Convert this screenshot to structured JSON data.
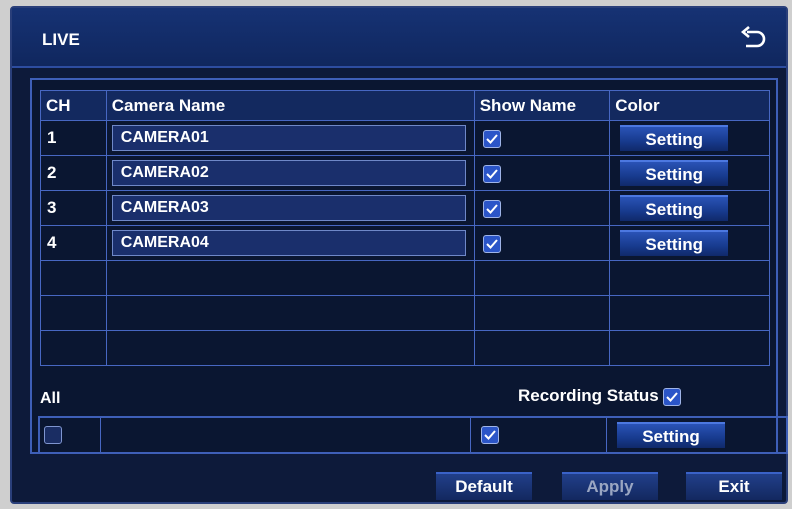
{
  "window": {
    "title": "LIVE"
  },
  "table": {
    "headers": {
      "ch": "CH",
      "name": "Camera Name",
      "show": "Show Name",
      "color": "Color"
    },
    "rows": [
      {
        "ch": "1",
        "name": "CAMERA01",
        "show_name": true,
        "color_btn": "Setting"
      },
      {
        "ch": "2",
        "name": "CAMERA02",
        "show_name": true,
        "color_btn": "Setting"
      },
      {
        "ch": "3",
        "name": "CAMERA03",
        "show_name": true,
        "color_btn": "Setting"
      },
      {
        "ch": "4",
        "name": "CAMERA04",
        "show_name": true,
        "color_btn": "Setting"
      }
    ]
  },
  "all": {
    "label": "All",
    "recording_status_label": "Recording Status",
    "recording_status_checked": true,
    "all_checked": false,
    "show_name_checked": true,
    "color_btn": "Setting"
  },
  "footer": {
    "default": "Default",
    "apply": "Apply",
    "exit": "Exit"
  },
  "colors": {
    "accent": "#2b55c8",
    "background": "#0d1a3a",
    "border": "#4767c2"
  }
}
